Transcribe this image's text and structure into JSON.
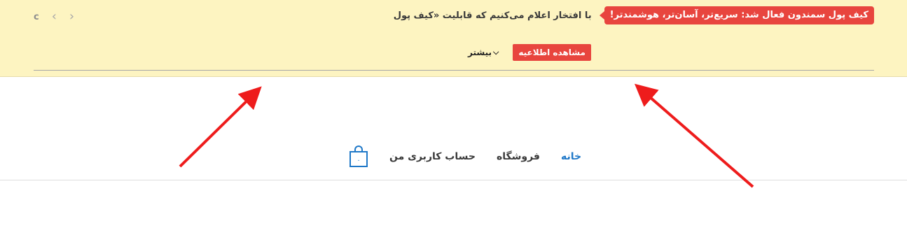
{
  "notice": {
    "badge": "کیف پول سمندون فعال شد: سریع‌تر، آسان‌تر، هوشمندتر!",
    "text": "با افتخار اعلام می‌کنیم که قابلیت «کیف پول",
    "more_label": "بیشتر",
    "view_button": "مشاهده اطلاعیه",
    "counter": "c",
    "prev_icon": "chevron-left-icon",
    "next_icon": "chevron-right-icon",
    "accent_color": "#e8453e",
    "background_color": "#fdf4c1"
  },
  "menu": {
    "items": [
      {
        "label": "خانه",
        "active": true
      },
      {
        "label": "فروشگاه",
        "active": false
      },
      {
        "label": "حساب کاربری من",
        "active": false
      }
    ],
    "cart_count": "۰",
    "cart_icon": "shopping-bag-icon",
    "active_color": "#1f78c8"
  },
  "annotations": {
    "arrow_color": "#ee1c1c",
    "arrow_icon": "red-arrow-icon"
  }
}
